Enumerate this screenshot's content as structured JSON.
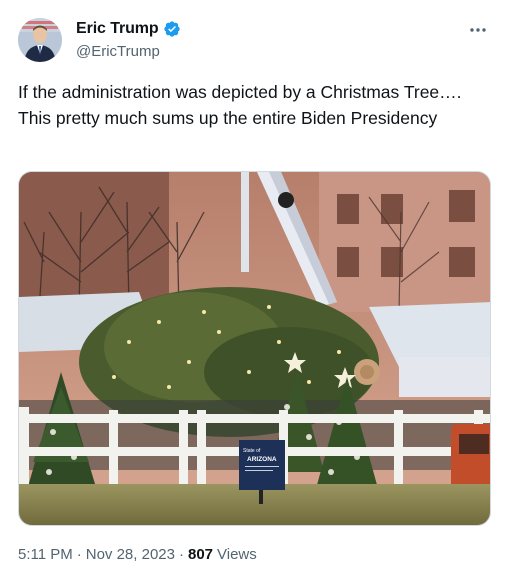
{
  "author": {
    "display_name": "Eric Trump",
    "handle": "@EricTrump",
    "verified_icon": "verified-badge-icon",
    "verified_color": "#1d9bf0"
  },
  "more_icon": "more-dots-icon",
  "tweet": {
    "text": "If the administration was depicted by a Christmas Tree…. This pretty much sums up the entire Biden Presidency"
  },
  "media": {
    "sign_line1": "State of",
    "sign_line2": "ARIZONA"
  },
  "meta": {
    "time": "5:11 PM",
    "separator1": "·",
    "date": "Nov 28, 2023",
    "separator2": "·",
    "views_count": "807",
    "views_label": "Views"
  },
  "colors": {
    "text_primary": "#0f1419",
    "text_secondary": "#536471",
    "border": "#cfd9de"
  }
}
